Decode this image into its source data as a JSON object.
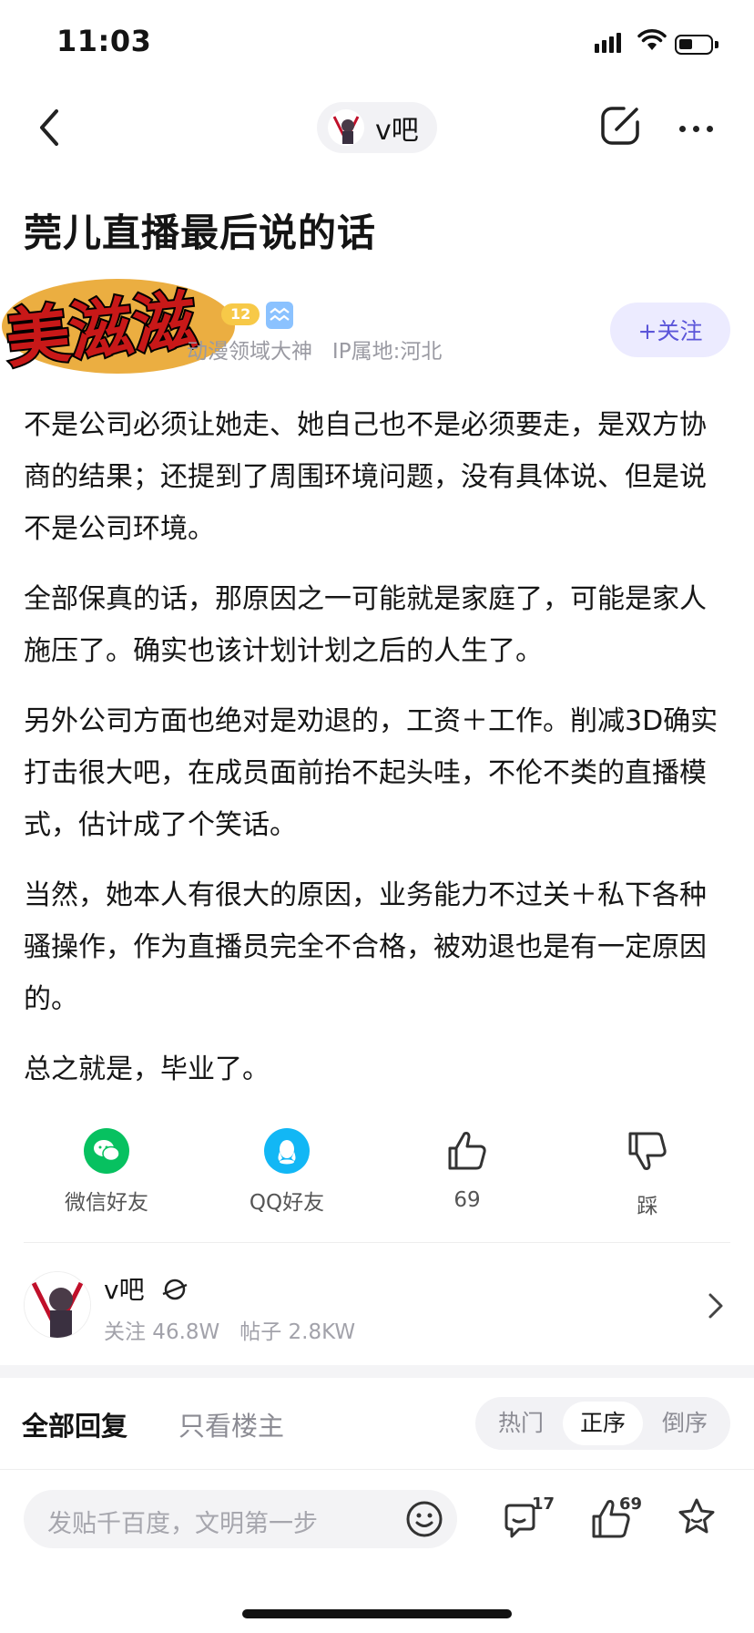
{
  "status_bar": {
    "time": "11:03"
  },
  "nav": {
    "forum_name": "v吧"
  },
  "post": {
    "title": "莞儿直播最后说的话",
    "sticker_text": "美滋滋",
    "level": "12",
    "author_meta": "动漫领域大神   IP属地:河北",
    "follow_label": "+关注",
    "paragraphs": [
      "不是公司必须让她走、她自己也不是必须要走，是双方协商的结果；还提到了周围环境问题，没有具体说、但是说不是公司环境。",
      "全部保真的话，那原因之一可能就是家庭了，可能是家人施压了。确实也该计划计划之后的人生了。",
      "另外公司方面也绝对是劝退的，工资＋工作。削减3D确实打击很大吧，在成员面前抬不起头哇，不伦不类的直播模式，估计成了个笑话。",
      "当然，她本人有很大的原因，业务能力不过关＋私下各种骚操作，作为直播员完全不合格，被劝退也是有一定原因的。",
      "总之就是，毕业了。"
    ]
  },
  "actions": {
    "wechat": "微信好友",
    "qq": "QQ好友",
    "like_count": "69",
    "dislike": "踩"
  },
  "forum_card": {
    "name": "v吧",
    "stats": "关注 46.8W   帖子 2.8KW"
  },
  "replies": {
    "tab_all": "全部回复",
    "tab_op": "只看楼主",
    "sort": [
      "热门",
      "正序",
      "倒序"
    ],
    "active_sort": "正序"
  },
  "bottom_bar": {
    "input_placeholder": "发贴千百度，文明第一步",
    "comment_count": "17",
    "like_count": "69"
  },
  "colors": {
    "accent": "#5b55d9",
    "follow_bg": "#ecebff",
    "wechat": "#07c160",
    "qq": "#12b7f5"
  }
}
